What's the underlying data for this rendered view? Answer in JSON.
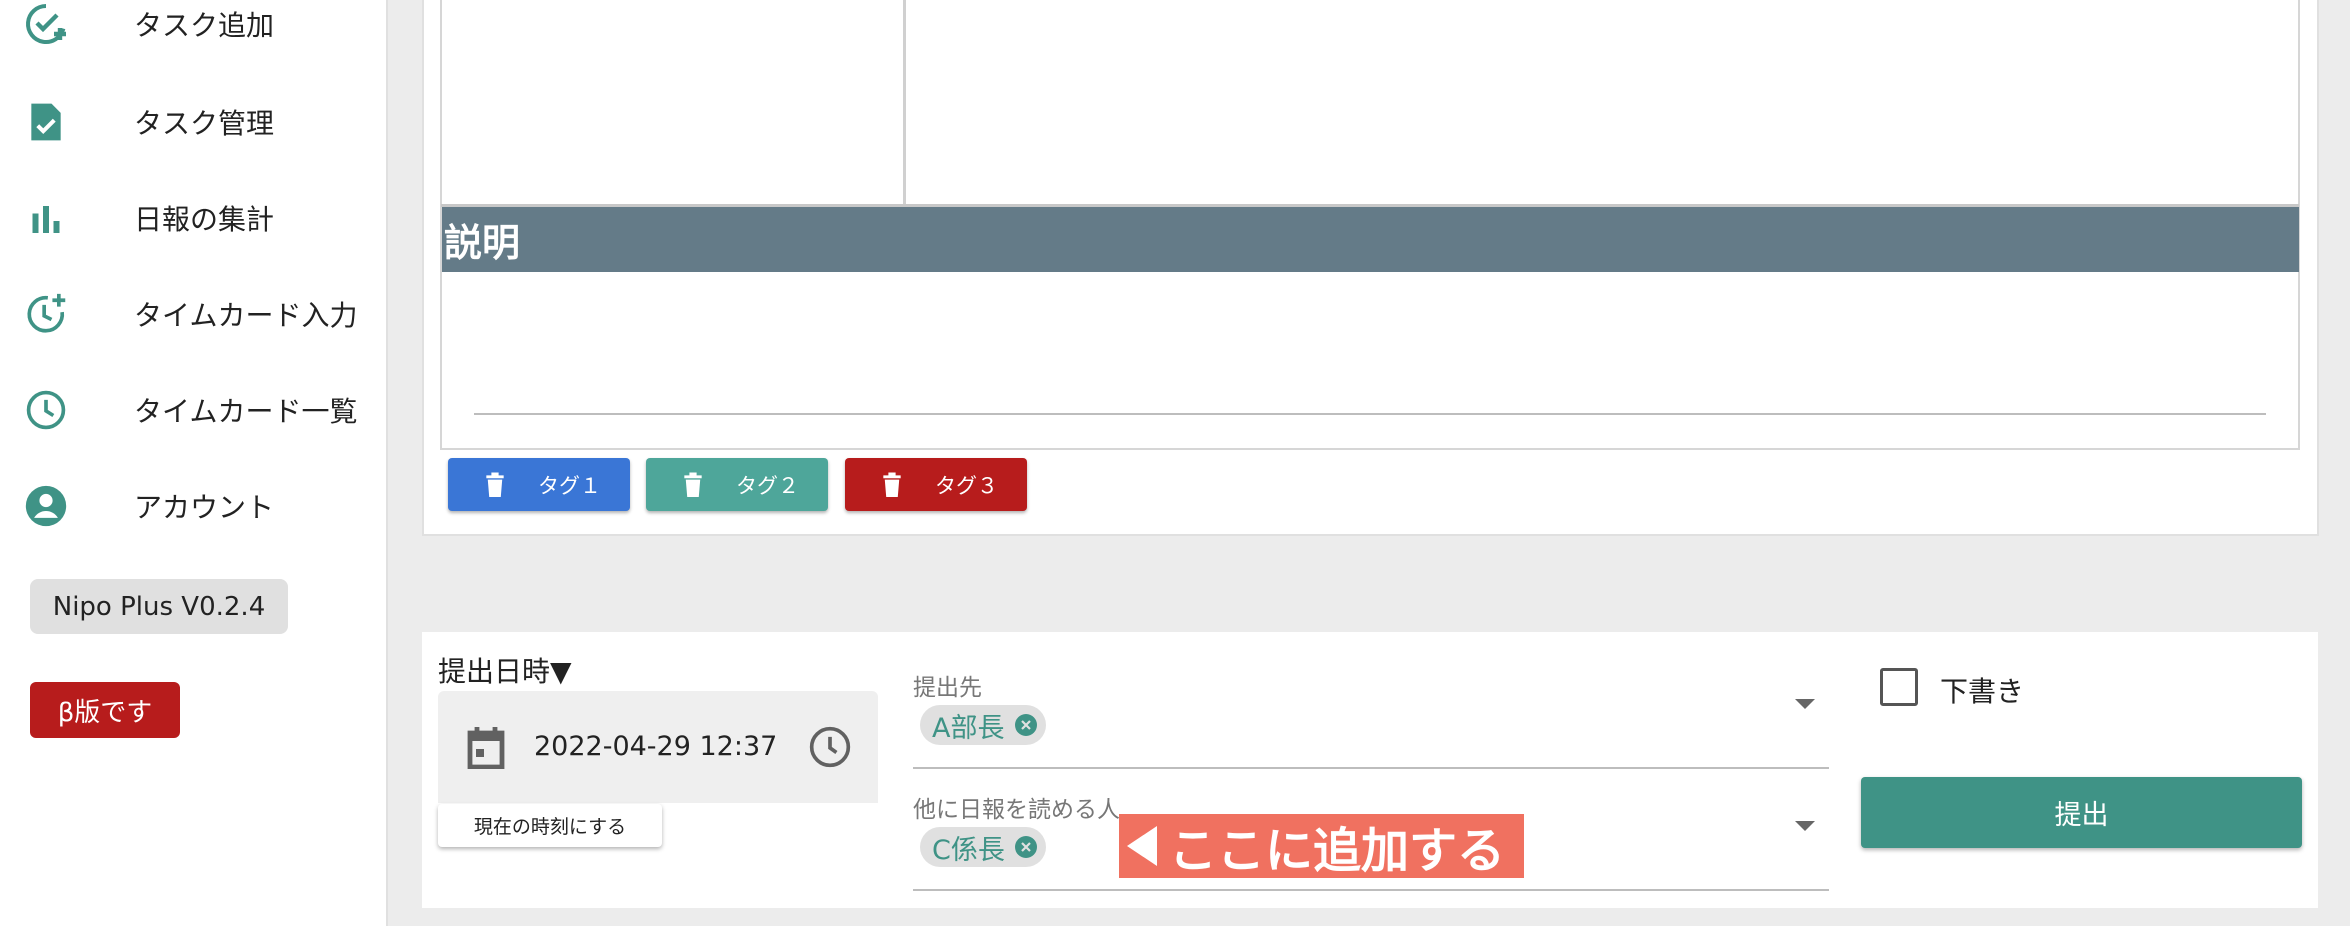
{
  "colors": {
    "accent_teal": "#3f9386",
    "tag1": "#3a76d6",
    "tag2": "#4ea69a",
    "tag3": "#b71c1c",
    "header_slate": "#647b88",
    "beta_red": "#b71c1c",
    "annotation_coral": "#f07160"
  },
  "sidebar": {
    "items": [
      {
        "label": "タスク追加",
        "icon": "task-add-icon"
      },
      {
        "label": "タスク管理",
        "icon": "task-manage-icon"
      },
      {
        "label": "日報の集計",
        "icon": "bar-chart-icon"
      },
      {
        "label": "タイムカード入力",
        "icon": "timecard-input-icon"
      },
      {
        "label": "タイムカード一覧",
        "icon": "clock-icon"
      },
      {
        "label": "アカウント",
        "icon": "account-icon"
      }
    ],
    "version": "Nipo Plus V0.2.4",
    "beta": "β版です"
  },
  "main": {
    "description_header": "説明",
    "tags": [
      {
        "label": "タグ１",
        "icon": "trash-icon"
      },
      {
        "label": "タグ２",
        "icon": "trash-icon"
      },
      {
        "label": "タグ３",
        "icon": "trash-icon"
      }
    ]
  },
  "submission": {
    "date_label": "提出日時▼",
    "date_value": "2022-04-29 12:37",
    "now_button": "現在の時刻にする",
    "recipient_label": "提出先",
    "recipient_chip": "A部長",
    "readers_label": "他に日報を読める人",
    "readers_chip": "C係長",
    "annotation": "ここに追加する",
    "draft_label": "下書き",
    "draft_checked": false,
    "submit_button": "提出"
  }
}
